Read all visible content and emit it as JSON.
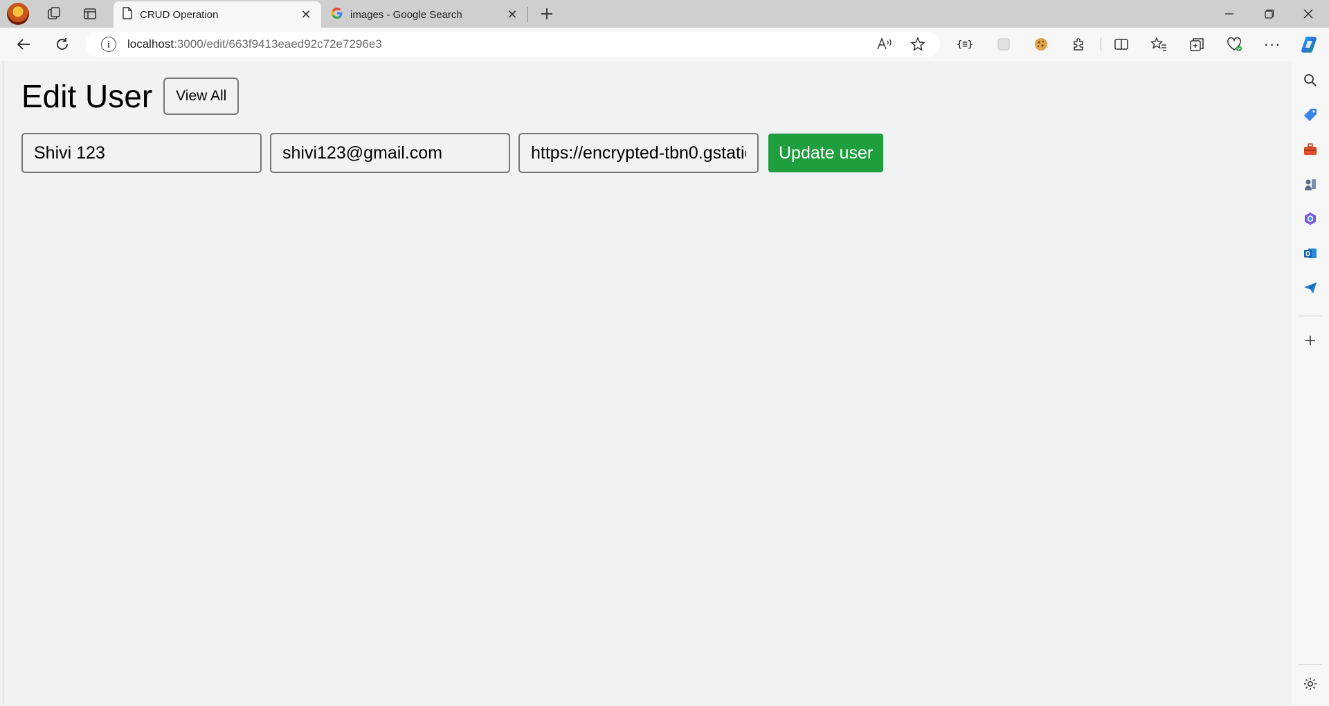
{
  "browser": {
    "tabs": [
      {
        "title": "CRUD Operation",
        "icon": "page-icon"
      },
      {
        "title": "images - Google Search",
        "icon": "google-icon"
      }
    ],
    "url": {
      "host": "localhost",
      "path": ":3000/edit/663f9413eaed92c72e7296e3"
    }
  },
  "page": {
    "title": "Edit User",
    "view_all_label": "View All",
    "form": {
      "name_value": "Shivi 123",
      "email_value": "shivi123@gmail.com",
      "image_value": "https://encrypted-tbn0.gstatic",
      "submit_label": "Update user"
    }
  },
  "colors": {
    "submit_button": "#1f9e3d",
    "page_background": "#f0f2f4"
  }
}
